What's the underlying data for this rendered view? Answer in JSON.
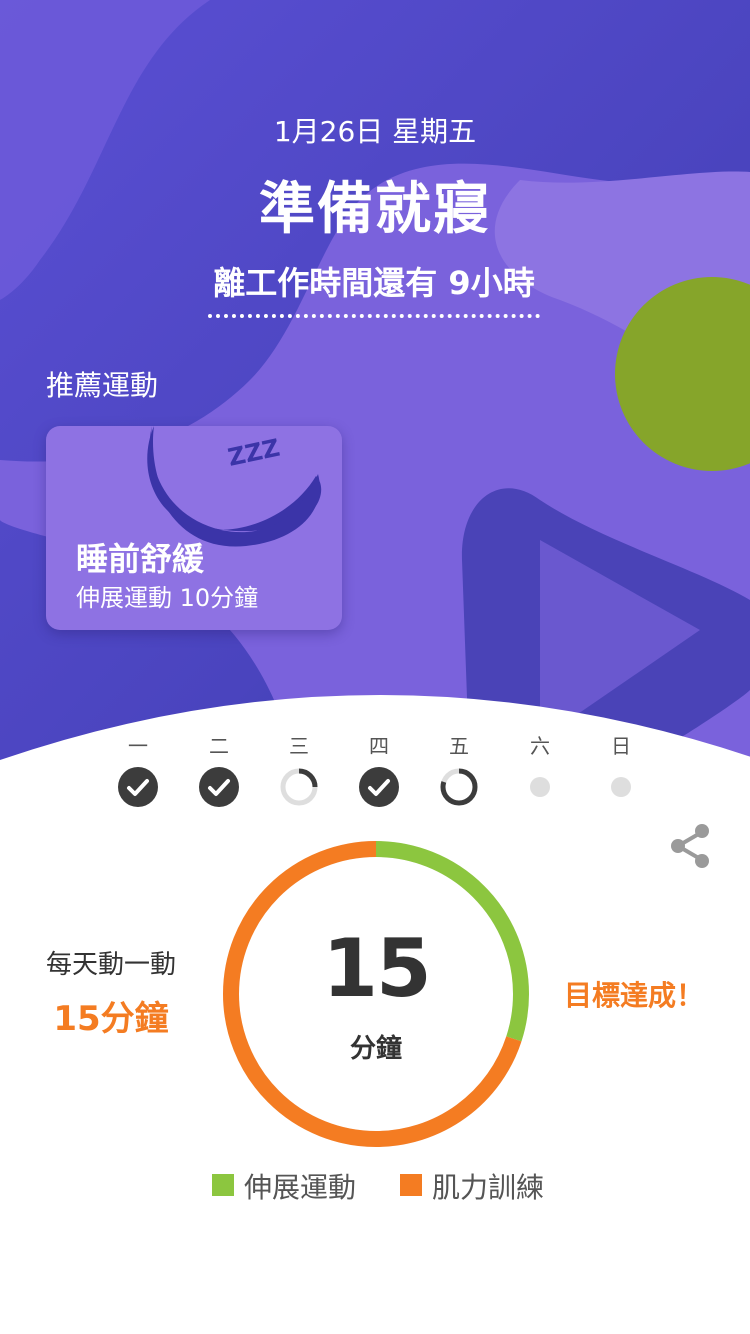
{
  "header": {
    "date": "1月26日 星期五",
    "title": "準備就寢",
    "countdown": "離工作時間還有 9小時"
  },
  "recommended": {
    "heading": "推薦運動",
    "card": {
      "title": "睡前舒緩",
      "subtitle": "伸展運動 10分鐘",
      "illustration": "moon-sleeping-icon",
      "zzz": "ZZZ"
    }
  },
  "week": {
    "days": [
      {
        "label": "一",
        "status": "completed"
      },
      {
        "label": "二",
        "status": "completed"
      },
      {
        "label": "三",
        "status": "partial",
        "progress": 0.25
      },
      {
        "label": "四",
        "status": "completed"
      },
      {
        "label": "五",
        "status": "partial",
        "progress": 0.8
      },
      {
        "label": "六",
        "status": "none"
      },
      {
        "label": "日",
        "status": "none"
      }
    ]
  },
  "summary": {
    "goal_label": "每天動一動",
    "goal_value": "15分鐘",
    "minutes": "15",
    "unit": "分鐘",
    "status": "目標達成！",
    "share_icon": "share-icon"
  },
  "breakdown": [
    {
      "name": "伸展運動",
      "color": "#8cc63f",
      "fraction": 0.3
    },
    {
      "name": "肌力訓練",
      "color": "#f47c22",
      "fraction": 0.7
    }
  ],
  "colors": {
    "accent": "#f47c22",
    "hero_gradient_start": "#5a4bd0",
    "hero_gradient_end": "#3f3aa8",
    "completed": "#3c3c3c",
    "inactive": "#dedede"
  }
}
